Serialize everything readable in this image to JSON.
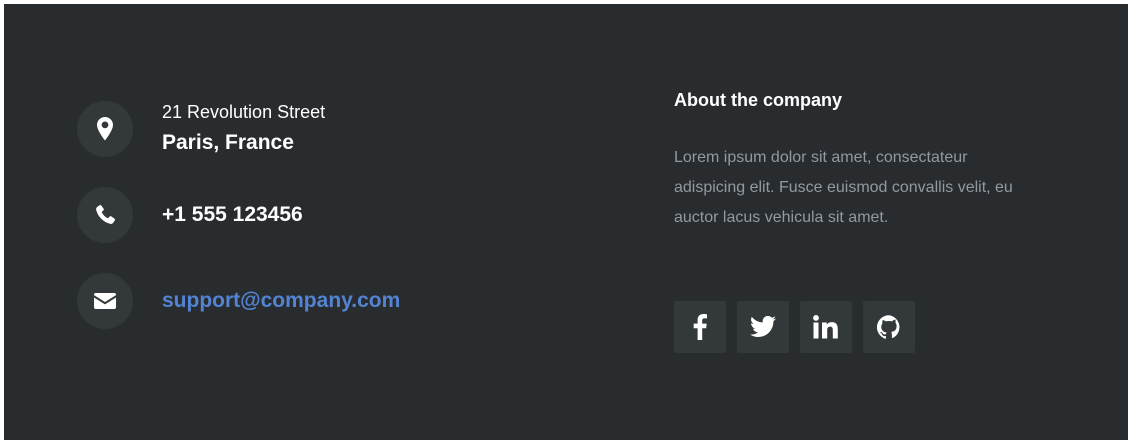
{
  "contact": {
    "address": {
      "street": "21 Revolution Street",
      "city": "Paris, France",
      "icon": "map-marker-icon"
    },
    "phone": {
      "number": "+1 555 123456",
      "icon": "phone-icon"
    },
    "email": {
      "address": "support@company.com",
      "icon": "envelope-icon"
    }
  },
  "about": {
    "title": "About the company",
    "text": "Lorem ipsum dolor sit amet, consectateur adispicing elit. Fusce euismod convallis velit, eu auctor lacus vehicula sit amet."
  },
  "socials": [
    {
      "icon": "facebook-icon"
    },
    {
      "icon": "twitter-icon"
    },
    {
      "icon": "linkedin-icon"
    },
    {
      "icon": "github-icon"
    }
  ],
  "colors": {
    "background": "#292c2f",
    "icon_background": "#33383b",
    "link": "#5383d3",
    "muted_text": "#92999f"
  }
}
